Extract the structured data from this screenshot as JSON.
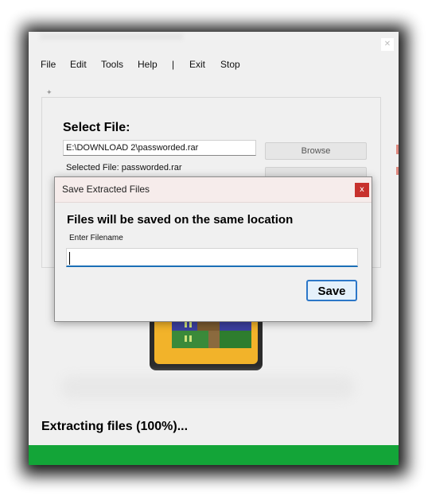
{
  "menu": {
    "items": [
      "File",
      "Edit",
      "Tools",
      "Help",
      "|",
      "Exit",
      "Stop"
    ]
  },
  "main": {
    "select_title": "Select File:",
    "path_value": "E:\\DOWNLOAD 2\\passworded.rar",
    "browse_label": "Browse",
    "selected_file_text": "Selected File: passworded.rar",
    "status_text": "Extracting files (100%)...",
    "progress_percent": 100,
    "progress_color": "#13a538"
  },
  "dialog": {
    "title": "Save Extracted Files",
    "close_glyph": "x",
    "heading": "Files will be saved on the same location",
    "label": "Enter Filename",
    "filename_value": "",
    "save_label": "Save"
  },
  "icons": {
    "main_close": "close-icon",
    "logo": "winrar-books-icon"
  }
}
